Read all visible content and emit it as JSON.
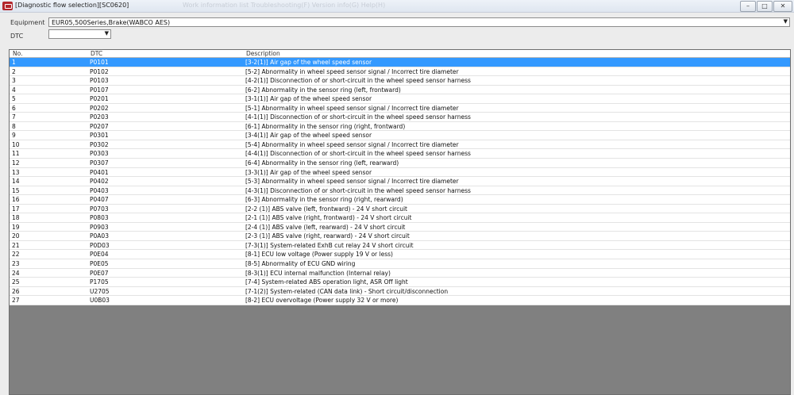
{
  "window": {
    "title": "[Diagnostic flow selection][SC0620]",
    "menu_ghost": "Work information list    Troubleshooting(F)    Version info(G)    Help(H)",
    "controls": [
      "–",
      "□",
      "✕"
    ]
  },
  "filters": {
    "equipment_label": "Equipment",
    "equipment_value": "EUR05,500Series,Brake(WABCO AES)",
    "dtc_label": "DTC",
    "dtc_value": ""
  },
  "table": {
    "columns": [
      "No.",
      "DTC",
      "Description"
    ],
    "selected_index": 0,
    "rows": [
      {
        "no": "1",
        "dtc": "P0101",
        "desc": "[3-2(1)] Air gap of the wheel speed sensor"
      },
      {
        "no": "2",
        "dtc": "P0102",
        "desc": "[5-2] Abnormality in wheel speed sensor signal / Incorrect tire diameter"
      },
      {
        "no": "3",
        "dtc": "P0103",
        "desc": "[4-2(1)] Disconnection of or short-circuit in the wheel speed sensor harness"
      },
      {
        "no": "4",
        "dtc": "P0107",
        "desc": "[6-2] Abnormality in the sensor ring (left, frontward)"
      },
      {
        "no": "5",
        "dtc": "P0201",
        "desc": "[3-1(1)] Air gap of the wheel speed sensor"
      },
      {
        "no": "6",
        "dtc": "P0202",
        "desc": "[5-1] Abnormality in wheel speed sensor signal / Incorrect tire diameter"
      },
      {
        "no": "7",
        "dtc": "P0203",
        "desc": "[4-1(1)] Disconnection of or short-circuit in the wheel speed sensor harness"
      },
      {
        "no": "8",
        "dtc": "P0207",
        "desc": "[6-1] Abnormality in the sensor ring (right, frontward)"
      },
      {
        "no": "9",
        "dtc": "P0301",
        "desc": "[3-4(1)] Air gap of the wheel speed sensor"
      },
      {
        "no": "10",
        "dtc": "P0302",
        "desc": "[5-4] Abnormality in wheel speed sensor signal / Incorrect tire diameter"
      },
      {
        "no": "11",
        "dtc": "P0303",
        "desc": "[4-4(1)] Disconnection of or short-circuit in the wheel speed sensor harness"
      },
      {
        "no": "12",
        "dtc": "P0307",
        "desc": "[6-4] Abnormality in the sensor ring (left, rearward)"
      },
      {
        "no": "13",
        "dtc": "P0401",
        "desc": "[3-3(1)] Air gap of the wheel speed sensor"
      },
      {
        "no": "14",
        "dtc": "P0402",
        "desc": "[5-3] Abnormality in wheel speed sensor signal / Incorrect tire diameter"
      },
      {
        "no": "15",
        "dtc": "P0403",
        "desc": "[4-3(1)] Disconnection of or short-circuit in the wheel speed sensor harness"
      },
      {
        "no": "16",
        "dtc": "P0407",
        "desc": "[6-3] Abnormality in the sensor ring (right, rearward)"
      },
      {
        "no": "17",
        "dtc": "P0703",
        "desc": "[2-2 (1)] ABS valve (left, frontward) - 24 V short circuit"
      },
      {
        "no": "18",
        "dtc": "P0803",
        "desc": "[2-1 (1)] ABS valve (right, frontward) - 24 V short circuit"
      },
      {
        "no": "19",
        "dtc": "P0903",
        "desc": "[2-4 (1)] ABS valve (left, rearward) - 24 V short circuit"
      },
      {
        "no": "20",
        "dtc": "P0A03",
        "desc": "[2-3 (1)] ABS valve (right, rearward) - 24 V short circuit"
      },
      {
        "no": "21",
        "dtc": "P0D03",
        "desc": "[7-3(1)] System-related ExhB cut relay 24 V short circuit"
      },
      {
        "no": "22",
        "dtc": "P0E04",
        "desc": "[8-1] ECU low voltage (Power supply 19 V or less)"
      },
      {
        "no": "23",
        "dtc": "P0E05",
        "desc": "[8-5] Abnormality of ECU GND wiring"
      },
      {
        "no": "24",
        "dtc": "P0E07",
        "desc": "[8-3(1)] ECU internal malfunction (Internal relay)"
      },
      {
        "no": "25",
        "dtc": "P1705",
        "desc": "[7-4] System-related ABS operation light, ASR Off light"
      },
      {
        "no": "26",
        "dtc": "U2705",
        "desc": "[7-1(2)] System-related (CAN data link) - Short circuit/disconnection"
      },
      {
        "no": "27",
        "dtc": "U0B03",
        "desc": "[8-2] ECU overvoltage (Power supply 32 V or more)"
      }
    ]
  },
  "colors": {
    "selection": "#3399ff",
    "empty_area": "#808080",
    "app_icon": "#b3262c"
  }
}
